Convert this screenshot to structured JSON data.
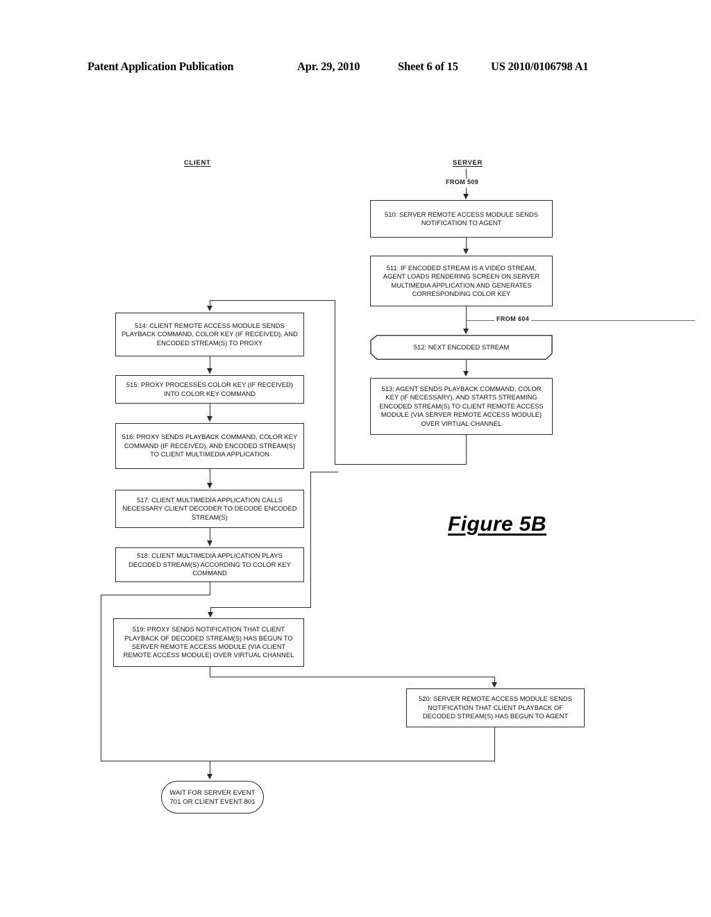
{
  "header": {
    "publication": "Patent Application Publication",
    "date": "Apr. 29, 2010",
    "sheet": "Sheet 6 of 15",
    "patent_number": "US 2010/0106798 A1"
  },
  "figure": {
    "caption": "Figure 5B"
  },
  "columns": {
    "client": "CLIENT",
    "server": "SERVER"
  },
  "connector_labels": {
    "from_509": "FROM 509",
    "from_604": "FROM 604"
  },
  "nodes": {
    "n510": "510: SERVER REMOTE ACCESS MODULE SENDS NOTIFICATION TO AGENT",
    "n511": "511: IF ENCODED STREAM IS A VIDEO STREAM, AGENT LOADS RENDERING SCREEN ON SERVER MULTIMEDIA APPLICATION AND GENERATES CORRESPONDING COLOR KEY",
    "n512": "512: NEXT ENCODED STREAM",
    "n513": "513: AGENT SENDS PLAYBACK COMMAND, COLOR KEY (IF NECESSARY), AND STARTS STREAMING ENCODED STREAM(S) TO CLIENT REMOTE ACCESS MODULE (VIA SERVER REMOTE ACCESS MODULE) OVER VIRTUAL CHANNEL",
    "n514": "514: CLIENT REMOTE ACCESS MODULE SENDS PLAYBACK COMMAND, COLOR KEY  (IF RECEIVED), AND ENCODED STREAM(S) TO PROXY",
    "n515": "515: PROXY PROCESSES COLOR KEY (IF RECEIVED) INTO COLOR KEY COMMAND",
    "n516": "516: PROXY SENDS PLAYBACK COMMAND, COLOR KEY COMMAND (IF RECEIVED), AND ENCODED STREAM(S) TO CLIENT MULTIMEDIA APPLICATION",
    "n517": "517: CLIENT MULTIMEDIA APPLICATION CALLS NECESSARY CLIENT DECODER TO DECODE ENCODED STREAM(S)",
    "n518": "518: CLIENT MULTIMEDIA APPLICATION PLAYS DECODED STREAM(S) ACCORDING TO COLOR KEY COMMAND",
    "n519": "519: PROXY SENDS NOTIFICATION THAT CLIENT PLAYBACK OF DECODED STREAM(S) HAS BEGUN TO SERVER REMOTE ACCESS MODULE (VIA CLIENT REMOTE ACCESS MODULE) OVER VIRTUAL CHANNEL",
    "n520": "520: SERVER REMOTE ACCESS MODULE SENDS NOTIFICATION THAT CLIENT PLAYBACK OF DECODED STREAM(S) HAS BEGUN TO AGENT",
    "terminal": "WAIT FOR SERVER EVENT 701 OR CLIENT EVENT 801"
  },
  "colors": {
    "ink": "#2b2b2b",
    "paper": "#ffffff"
  }
}
